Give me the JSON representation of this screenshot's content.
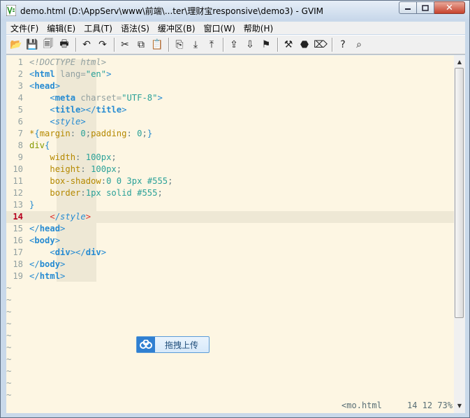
{
  "window": {
    "title": "demo.html (D:\\AppServ\\www\\前端\\...ter\\理财宝responsive\\demo3) - GVIM"
  },
  "menu": [
    "文件(F)",
    "编辑(E)",
    "工具(T)",
    "语法(S)",
    "缓冲区(B)",
    "窗口(W)",
    "帮助(H)"
  ],
  "toolbar": [
    {
      "icon": "open-icon"
    },
    {
      "icon": "save-icon"
    },
    {
      "icon": "save-all-icon"
    },
    {
      "icon": "print-icon"
    },
    "sep",
    {
      "icon": "undo-icon"
    },
    {
      "icon": "redo-icon"
    },
    "sep",
    {
      "icon": "cut-icon"
    },
    {
      "icon": "copy-icon"
    },
    {
      "icon": "paste-icon"
    },
    "sep",
    {
      "icon": "find-replace-icon"
    },
    {
      "icon": "find-next-icon"
    },
    {
      "icon": "find-prev-icon"
    },
    "sep",
    {
      "icon": "load-session-icon"
    },
    {
      "icon": "save-session-icon"
    },
    {
      "icon": "run-script-icon"
    },
    "sep",
    {
      "icon": "make-icon"
    },
    {
      "icon": "shell-icon"
    },
    {
      "icon": "tag-icon"
    },
    "sep",
    {
      "icon": "help-icon"
    },
    {
      "icon": "find-help-icon"
    }
  ],
  "code_lines": [
    {
      "n": "1",
      "html": "<span class='t-comment'>&lt;!DOCTYPE html&gt;</span>"
    },
    {
      "n": "2",
      "html": "<span class='t-br'>&lt;</span><span class='t-tag'>html</span> <span class='t-attr'>lang=</span><span class='t-str'>\"en\"</span><span class='t-br'>&gt;</span>"
    },
    {
      "n": "3",
      "html": "<span class='t-br'>&lt;</span><span class='t-tag'>head</span><span class='t-br'>&gt;</span>"
    },
    {
      "n": "4",
      "html": "    <span class='t-br'>&lt;</span><span class='t-tag'>meta</span> <span class='t-attr'>charset=</span><span class='t-str'>\"UTF-8\"</span><span class='t-br'>&gt;</span>"
    },
    {
      "n": "5",
      "html": "    <span class='t-br'>&lt;</span><span class='t-tag'>title</span><span class='t-br'>&gt;&lt;/</span><span class='t-tag'>title</span><span class='t-br'>&gt;</span>"
    },
    {
      "n": "6",
      "html": "    <span class='t-br'>&lt;</span><span class='t-italic'>style</span><span class='t-br'>&gt;</span>"
    },
    {
      "n": "7",
      "html": "<span class='t-prop'>*</span><span class='t-br'>{</span><span class='t-prop'>margin</span><span class='t-plain'>: </span><span class='t-num'>0</span><span class='t-plain'>;</span><span class='t-prop'>padding</span><span class='t-plain'>: </span><span class='t-num'>0</span><span class='t-plain'>;</span><span class='t-br'>}</span>"
    },
    {
      "n": "8",
      "html": "<span class='t-sel'>div</span><span class='t-br'>{</span>"
    },
    {
      "n": "9",
      "html": "    <span class='t-prop'>width</span><span class='t-plain'>: </span><span class='t-num'>100px</span><span class='t-plain'>;</span>"
    },
    {
      "n": "10",
      "html": "    <span class='t-prop'>height</span><span class='t-plain'>: </span><span class='t-num'>100px</span><span class='t-plain'>;</span>"
    },
    {
      "n": "11",
      "html": "    <span class='t-prop'>box-shadow</span><span class='t-plain'>:</span><span class='t-num'>0 0 3px #555</span><span class='t-plain'>;</span>"
    },
    {
      "n": "12",
      "html": "    <span class='t-prop'>border</span><span class='t-plain'>:</span><span class='t-num'>1px solid #555</span><span class='t-plain'>;</span>"
    },
    {
      "n": "13",
      "html": "<span class='t-br'>}</span>"
    },
    {
      "n": "14",
      "html": "    <span class='t-red'>&lt;</span><span class='t-br'>/</span><span class='t-italic'>style</span><span class='t-red'>&gt;</span>"
    },
    {
      "n": "15",
      "html": "<span class='t-br'>&lt;/</span><span class='t-tag'>head</span><span class='t-br'>&gt;</span>"
    },
    {
      "n": "16",
      "html": "<span class='t-br'>&lt;</span><span class='t-tag'>body</span><span class='t-br'>&gt;</span>"
    },
    {
      "n": "17",
      "html": "    <span class='t-br'>&lt;</span><span class='t-tag'>div</span><span class='t-br'>&gt;&lt;/</span><span class='t-tag'>div</span><span class='t-br'>&gt;</span>"
    },
    {
      "n": "18",
      "html": "<span class='t-br'>&lt;/</span><span class='t-tag'>body</span><span class='t-br'>&gt;</span>"
    },
    {
      "n": "19",
      "html": "<span class='t-br'>&lt;/</span><span class='t-tag'>html</span><span class='t-br'>&gt;</span>"
    }
  ],
  "current_line": "14",
  "tilde_count": 10,
  "statusbar": {
    "file": "<mo.html",
    "position": "14 12 73%"
  },
  "upload_widget": {
    "label": "拖拽上传"
  }
}
